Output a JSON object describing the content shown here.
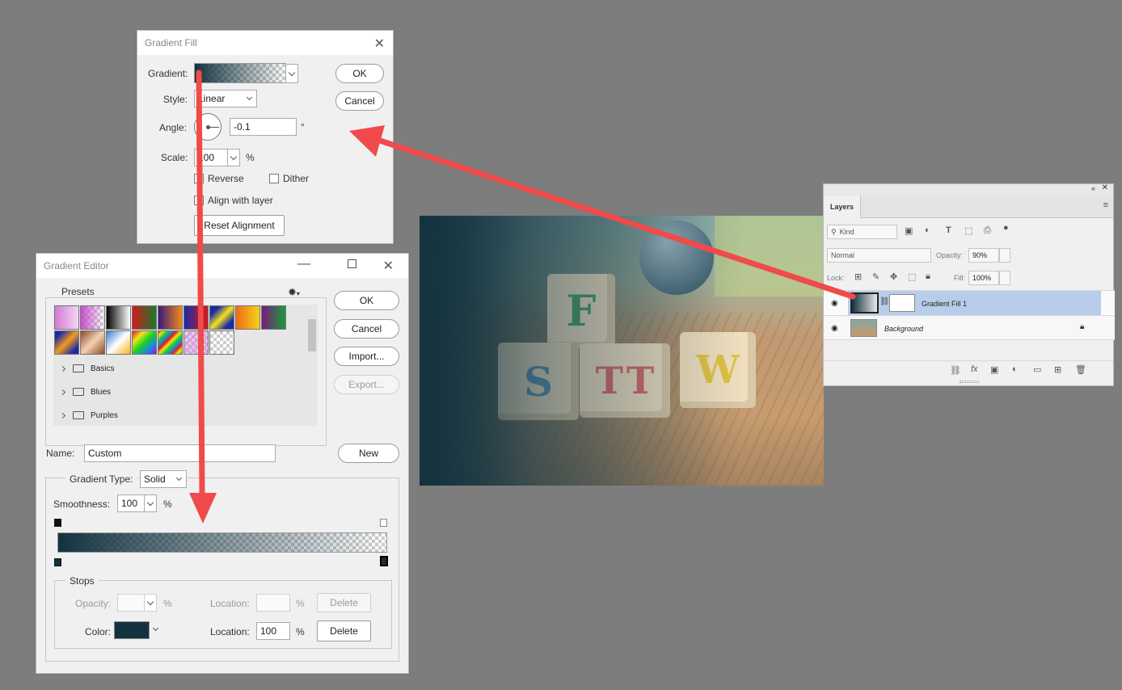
{
  "gradient_fill": {
    "title": "Gradient Fill",
    "gradient_label": "Gradient:",
    "style_label": "Style:",
    "style_value": "Linear",
    "angle_label": "Angle:",
    "angle_value": "-0.1",
    "degree_symbol": "°",
    "scale_label": "Scale:",
    "scale_value": "100",
    "percent": "%",
    "reverse_label": "Reverse",
    "dither_label": "Dither",
    "align_label": "Align with layer",
    "reset_label": "Reset Alignment",
    "ok_label": "OK",
    "cancel_label": "Cancel"
  },
  "gradient_editor": {
    "title": "Gradient Editor",
    "presets_label": "Presets",
    "folders": [
      "Basics",
      "Blues",
      "Purples"
    ],
    "ok_label": "OK",
    "cancel_label": "Cancel",
    "import_label": "Import...",
    "export_label": "Export...",
    "name_label": "Name:",
    "name_value": "Custom",
    "new_label": "New",
    "gradient_type_label": "Gradient Type:",
    "gradient_type_value": "Solid",
    "smoothness_label": "Smoothness:",
    "smoothness_value": "100",
    "percent": "%",
    "stops_label": "Stops",
    "opacity_label": "Opacity:",
    "location_label": "Location:",
    "location_value": "100",
    "color_label": "Color:",
    "delete_label": "Delete",
    "stop_color": "#12323f"
  },
  "photo": {
    "blocks": [
      "F",
      "S",
      "T",
      "T",
      "W"
    ]
  },
  "layers_panel": {
    "tab": "Layers",
    "kind_label": "Kind",
    "blend_mode": "Normal",
    "opacity_label": "Opacity:",
    "opacity_value": "90%",
    "lock_label": "Lock:",
    "fill_label": "Fill:",
    "fill_value": "100%",
    "layers": [
      {
        "name": "Gradient Fill 1",
        "selected": true
      },
      {
        "name": "Background",
        "selected": false
      }
    ]
  },
  "colors": {
    "arrow": "#f04a4a",
    "selected_layer": "#b8cde9",
    "gradient_dark": "#12323f"
  }
}
